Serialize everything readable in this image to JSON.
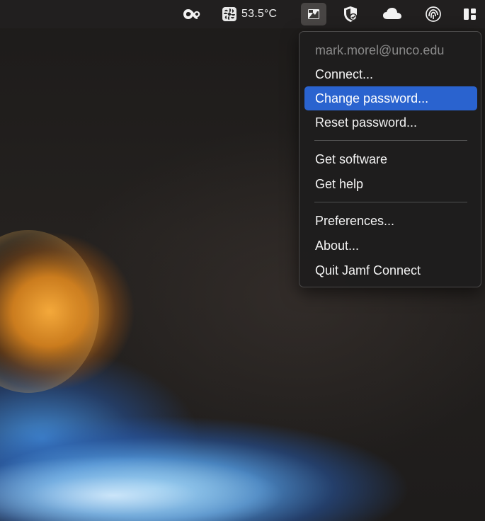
{
  "menubar": {
    "temperature": "53.5°C",
    "icons": {
      "creative_cloud": "creative-cloud-icon",
      "temperature": "fan-icon",
      "jamf_connect": "jamf-connect-icon",
      "security": "shield-check-icon",
      "cloud": "cloud-icon",
      "fingerprint": "fingerprint-icon",
      "control_center": "control-center-icon"
    }
  },
  "menu": {
    "account": "mark.morel@unco.edu",
    "items": [
      {
        "label": "Connect..."
      },
      {
        "label": "Change password...",
        "selected": true
      },
      {
        "label": "Reset password..."
      },
      {
        "label": "Get software"
      },
      {
        "label": "Get help"
      },
      {
        "label": "Preferences..."
      },
      {
        "label": "About..."
      },
      {
        "label": "Quit Jamf Connect"
      }
    ]
  },
  "colors": {
    "highlight": "#2a63cf",
    "menu_background": "#1e1d1d",
    "disabled_text": "#8a8a8a",
    "text": "#f3f3f3"
  }
}
